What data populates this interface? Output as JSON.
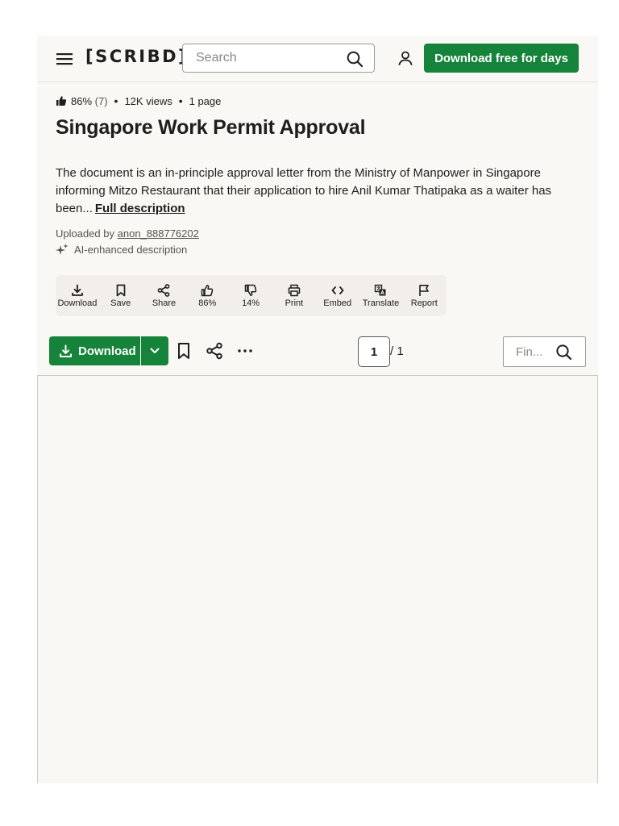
{
  "header": {
    "logo": "[SCRIBD]",
    "search_placeholder": "Search",
    "cta_label": "Download free for days"
  },
  "doc": {
    "rating": "86%",
    "rating_count": "(7)",
    "views": "12K views",
    "pages": "1 page",
    "title": "Singapore Work Permit Approval",
    "description": "The document is an in-principle approval letter from the Ministry of Manpower in Singapore informing Mitzo Restaurant that their application to hire Anil Kumar Thatipaka as a waiter has been...",
    "full_description_link": "Full description",
    "uploaded_by_label": "Uploaded by",
    "uploader": "anon_888776202",
    "ai_note": "AI-enhanced description"
  },
  "actions": [
    {
      "label": "Download",
      "icon": "download-icon"
    },
    {
      "label": "Save",
      "icon": "bookmark-icon"
    },
    {
      "label": "Share",
      "icon": "share-icon"
    },
    {
      "label": "86%",
      "icon": "thumbs-up-icon"
    },
    {
      "label": "14%",
      "icon": "thumbs-down-icon"
    },
    {
      "label": "Print",
      "icon": "print-icon"
    },
    {
      "label": "Embed",
      "icon": "embed-icon"
    },
    {
      "label": "Translate",
      "icon": "translate-icon"
    },
    {
      "label": "Report",
      "icon": "flag-icon"
    }
  ],
  "toolbar": {
    "download_label": "Download",
    "page_current": "1",
    "page_total": "/ 1",
    "find_placeholder": "Fin..."
  },
  "colors": {
    "brand_green": "#16833b",
    "panel_bg": "#faf8f5",
    "text": "#1e1e1e"
  }
}
